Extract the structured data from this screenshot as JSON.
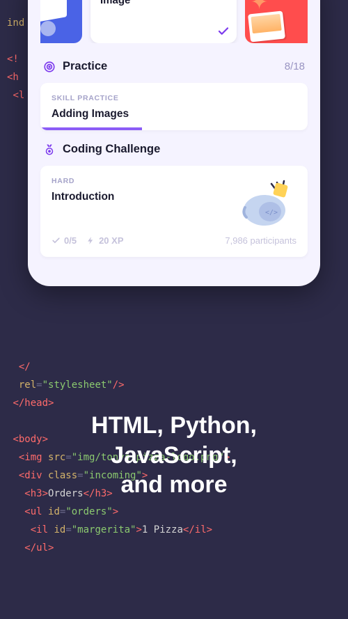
{
  "code_bg": {
    "line0": "ind",
    "lines_html": "\n<!\n<h\n <l\n\n\n\n\n\n\n\n\n\n\n\n\n\n\n\n\n  </\n  rel=\"stylesheet\"/>\n </head>\n\n <body>\n  <img src=\"img/tonys-pizza-logo.png\">\n  <div class=\"incoming\">\n   <h3>Orders</h3>\n   <ul id=\"orders\">\n    <il id=\"margerita\">1 Pizza</il>\n   </ul>\n"
  },
  "cards": {
    "center_label": "Image"
  },
  "practice": {
    "title": "Practice",
    "counter": "8/18",
    "eyebrow": "SKILL PRACTICE",
    "card_title": "Adding Images"
  },
  "challenge": {
    "title": "Coding Challenge",
    "eyebrow": "HARD",
    "card_title": "Introduction",
    "progress": "0/5",
    "xp": "20 XP",
    "participants": "7,986 participants"
  },
  "headline": {
    "line1": "HTML, Python,",
    "line2": "JavaScript,",
    "line3": "and more"
  }
}
